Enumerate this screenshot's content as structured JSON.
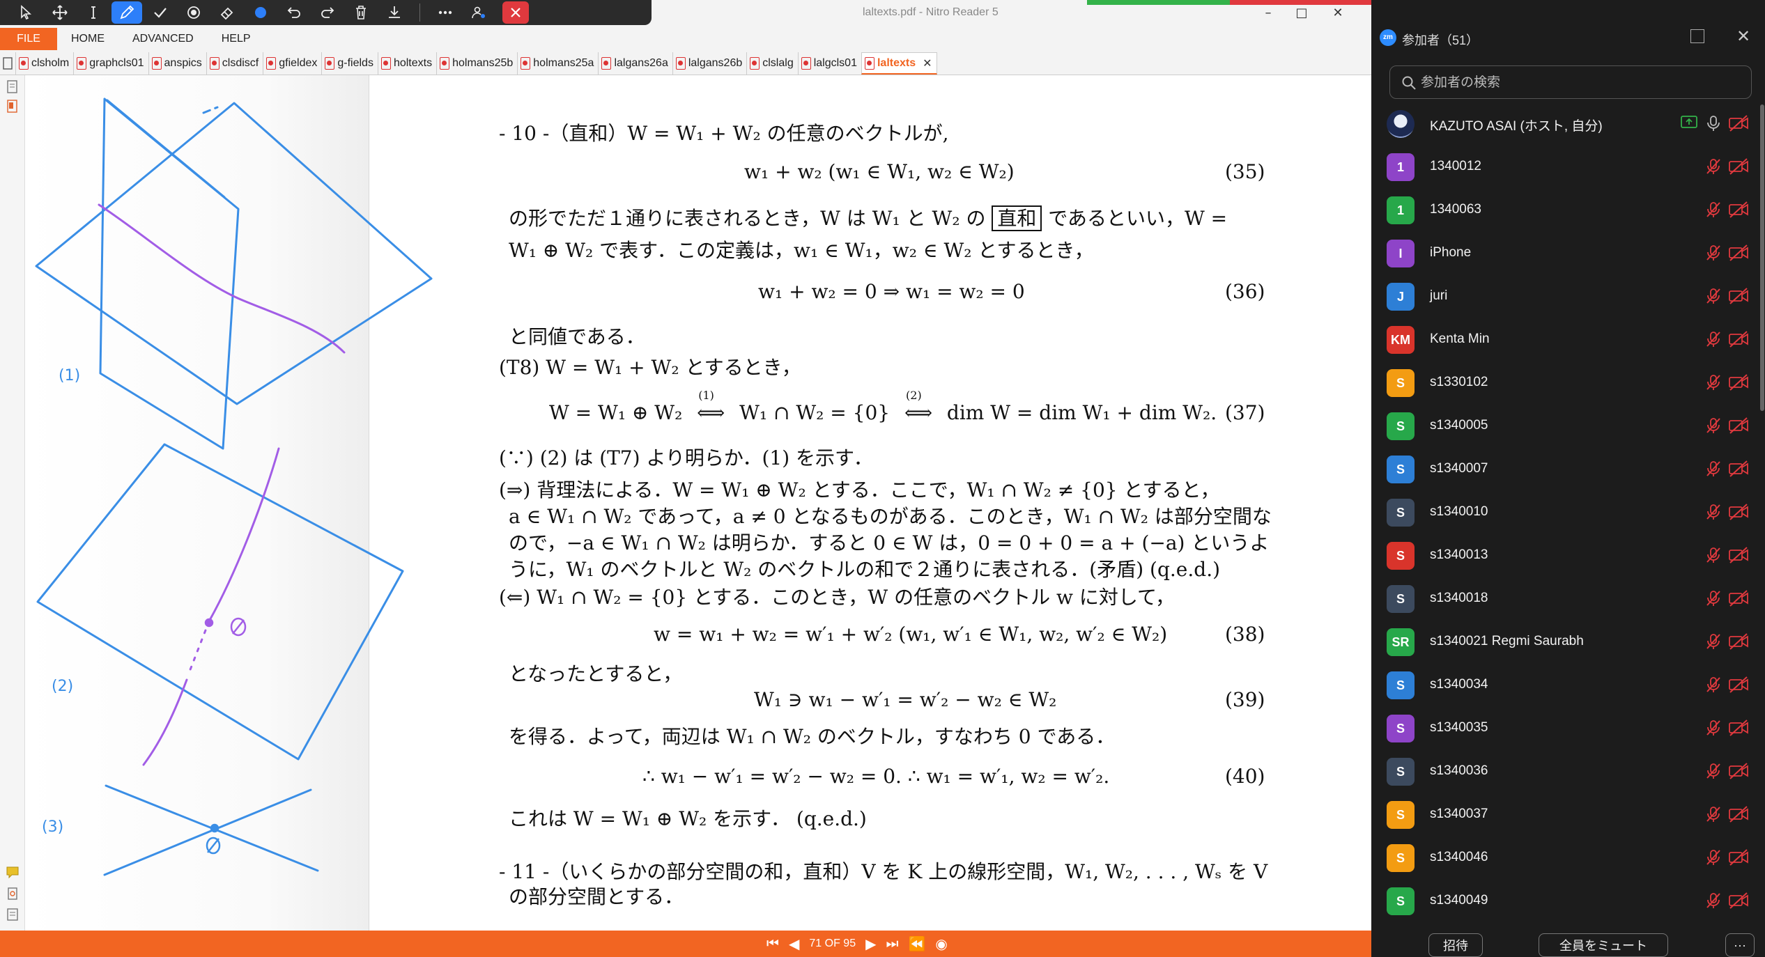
{
  "window": {
    "title": "laltexts.pdf - Nitro Reader 5"
  },
  "menubar": {
    "file": "FILE",
    "items": [
      "HOME",
      "ADVANCED",
      "HELP"
    ]
  },
  "tabs": [
    "clsholm",
    "graphcls01",
    "anspics",
    "clsdiscf",
    "gfieldex",
    "g-fields",
    "holtexts",
    "holmans25b",
    "holmans25a",
    "lalgans26a",
    "lalgans26b",
    "clslalg",
    "lalgcls01",
    "laltexts"
  ],
  "active_tab": "laltexts",
  "sketch": {
    "labels": [
      "(1)",
      "(2)",
      "(3)"
    ]
  },
  "document": {
    "s10_head": "- 10 -（直和）W = W₁ + W₂ の任意のベクトルが,",
    "eq35": "w₁ + w₂      (w₁ ∈ W₁,  w₂ ∈ W₂)",
    "eq35_no": "(35)",
    "p1a": "の形でただ１通りに表されるとき，W は W₁ と W₂ の",
    "p1_box": "直和",
    "p1b": "であるといい，W =",
    "p2": "W₁ ⊕ W₂ で表す．この定義は，w₁ ∈ W₁，w₂ ∈ W₂ とするとき，",
    "eq36": "w₁ + w₂ = 0  ⇒  w₁ = w₂ = 0",
    "eq36_no": "(36)",
    "p3": "と同値である．",
    "t8": "(T8)  W = W₁ + W₂ とするとき，",
    "eq37a": "W = W₁ ⊕ W₂",
    "eq37_arrow1": "(1)",
    "eq37b": "W₁ ∩ W₂ = {0}",
    "eq37_arrow2": "(2)",
    "eq37c": "dim W = dim W₁ + dim W₂.",
    "eq37_no": "(37)",
    "p4": "(∵) (2) は (T7) より明らか．(1) を示す．",
    "p5": "(⇒) 背理法による．W = W₁ ⊕ W₂ とする．ここで，W₁ ∩ W₂ ≠ {0} とすると，",
    "p6": "a ∈ W₁ ∩ W₂ であって，a ≠ 0 となるものがある．このとき，W₁ ∩ W₂ は部分空間な",
    "p7": "ので，−a ∈ W₁ ∩ W₂ は明らか．すると 0 ∈ W は，0 = 0 + 0 = a + (−a) というよ",
    "p8": "うに，W₁ のベクトルと W₂ のベクトルの和で２通りに表される．(矛盾)    (q.e.d.)",
    "p9": "(⇐) W₁ ∩ W₂ = {0} とする．このとき，W の任意のベクトル w に対して，",
    "eq38": "w = w₁ + w₂ = w′₁ + w′₂        (w₁, w′₁ ∈ W₁,  w₂, w′₂ ∈ W₂)",
    "eq38_no": "(38)",
    "p10": "となったとすると，",
    "eq39": "W₁ ∋ w₁ − w′₁ = w′₂ − w₂ ∈ W₂",
    "eq39_no": "(39)",
    "p11": "を得る．よって，両辺は W₁ ∩ W₂ のベクトル，すなわち 0 である．",
    "eq40": "∴   w₁ − w′₁ = w′₂ − w₂ = 0.      ∴   w₁ = w′₁,   w₂ = w′₂.",
    "eq40_no": "(40)",
    "p12": "これは W = W₁ ⊕ W₂ を示す．  (q.e.d.)",
    "s11_head": "- 11 -（いくらかの部分空間の和，直和）V を K 上の線形空間，W₁, W₂, . . . , Wₛ を V",
    "s11_cont": "の部分空間とする．"
  },
  "statusbar": {
    "page": "71 OF 95"
  },
  "zoom": {
    "title": "参加者（51）",
    "search_placeholder": "参加者の検索",
    "participants": [
      {
        "name": "KAZUTO ASAI (ホスト, 自分)",
        "initials": "",
        "color": "#5a6fd6",
        "photo": true
      },
      {
        "name": "1340012",
        "initials": "1",
        "color": "#8e44c8"
      },
      {
        "name": "1340063",
        "initials": "1",
        "color": "#27a84a"
      },
      {
        "name": "iPhone",
        "initials": "I",
        "color": "#8e44c8"
      },
      {
        "name": "juri",
        "initials": "J",
        "color": "#2d7fd6"
      },
      {
        "name": "Kenta Min",
        "initials": "KM",
        "color": "#d9342b"
      },
      {
        "name": "s1330102",
        "initials": "S",
        "color": "#f39c12"
      },
      {
        "name": "s1340005",
        "initials": "S",
        "color": "#27a84a"
      },
      {
        "name": "s1340007",
        "initials": "S",
        "color": "#2d7fd6"
      },
      {
        "name": "s1340010",
        "initials": "S",
        "color": "#3c4a5e"
      },
      {
        "name": "s1340013",
        "initials": "S",
        "color": "#d9342b"
      },
      {
        "name": "s1340018",
        "initials": "S",
        "color": "#3c4a5e"
      },
      {
        "name": "s1340021 Regmi Saurabh",
        "initials": "SR",
        "color": "#27a84a"
      },
      {
        "name": "s1340034",
        "initials": "S",
        "color": "#2d7fd6"
      },
      {
        "name": "s1340035",
        "initials": "S",
        "color": "#8e44c8"
      },
      {
        "name": "s1340036",
        "initials": "S",
        "color": "#3c4a5e"
      },
      {
        "name": "s1340037",
        "initials": "S",
        "color": "#f39c12"
      },
      {
        "name": "s1340046",
        "initials": "S",
        "color": "#f39c12"
      },
      {
        "name": "s1340049",
        "initials": "S",
        "color": "#27a84a"
      }
    ],
    "footer": {
      "invite": "招待",
      "mute_all": "全員をミュート",
      "more": "···"
    }
  }
}
